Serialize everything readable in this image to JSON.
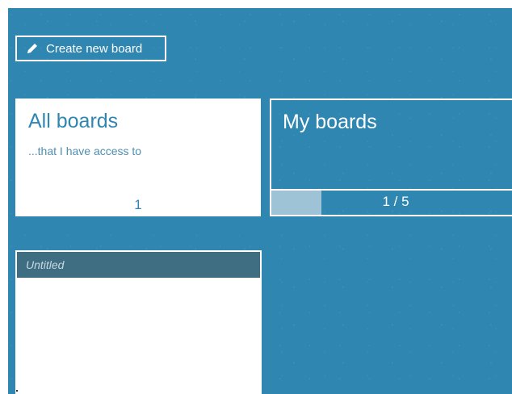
{
  "toolbar": {
    "create_label": "Create new board",
    "create_icon": "pencil-icon"
  },
  "tiles": {
    "all_boards": {
      "title": "All boards",
      "subtitle": "...that I have access to",
      "count": "1"
    },
    "my_boards": {
      "title": "My boards",
      "progress_text": "1 / 5",
      "progress_fraction": 0.2
    }
  },
  "boards": [
    {
      "title": "Untitled"
    }
  ],
  "colors": {
    "background": "#2f86b0",
    "card_header": "#3f6e83",
    "progress_fill": "#9ec3d6"
  }
}
